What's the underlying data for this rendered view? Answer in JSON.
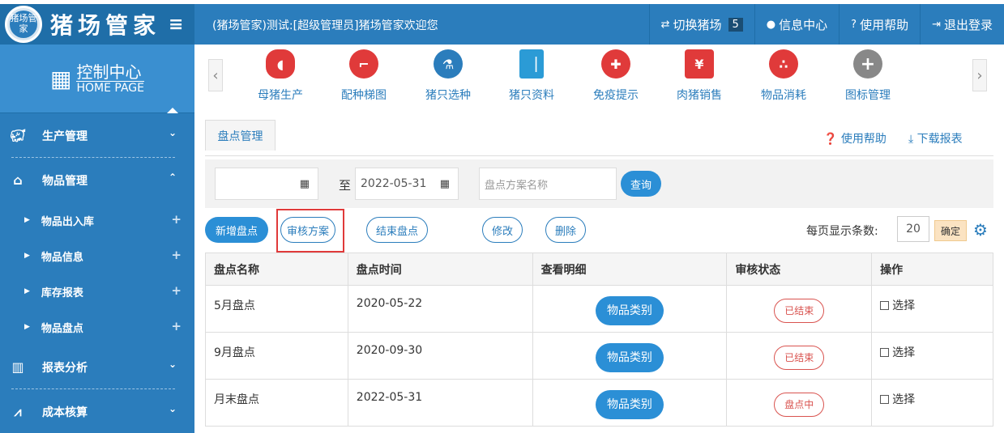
{
  "app": {
    "logo_text": "猪场管家",
    "title": "猪场管家",
    "welcome": "(猪场管家)测试:[超级管理员]猪场管家欢迎您"
  },
  "topnav": {
    "switch_farm": "切换猪场",
    "farm_count": "5",
    "info_center": "信息中心",
    "help": "使用帮助",
    "logout": "退出登录"
  },
  "sidebar": {
    "control_center": "控制中心",
    "home_page": "HOME PAGE",
    "menus": [
      {
        "label": "生产管理",
        "icon": "pig-outline-icon"
      },
      {
        "label": "物品管理",
        "icon": "warehouse-icon"
      },
      {
        "label": "报表分析",
        "icon": "chart-icon"
      },
      {
        "label": "成本核算",
        "icon": "cost-chart-icon"
      }
    ],
    "sub_items": [
      {
        "label": "物品出入库"
      },
      {
        "label": "物品信息"
      },
      {
        "label": "库存报表"
      },
      {
        "label": "物品盘点"
      }
    ]
  },
  "shortcuts": [
    {
      "label": "母猪生产",
      "icon": "pig-icon",
      "color": "#e03a3a"
    },
    {
      "label": "配种梯图",
      "icon": "stairs-icon",
      "color": "#e03a3a"
    },
    {
      "label": "猪只选种",
      "icon": "flask-icon",
      "color": "#2b7dbc"
    },
    {
      "label": "猪只资料",
      "icon": "book-icon",
      "color": "#2b9bd6"
    },
    {
      "label": "免疫提示",
      "icon": "heart-cross-icon",
      "color": "#e03a3a"
    },
    {
      "label": "肉猪销售",
      "icon": "money-stack-icon",
      "color": "#e03a3a"
    },
    {
      "label": "物品消耗",
      "icon": "circles-icon",
      "color": "#e03a3a"
    },
    {
      "label": "图标管理",
      "icon": "plus-circle-icon",
      "color": "#888888"
    }
  ],
  "tab": {
    "label": "盘点管理"
  },
  "links": {
    "help": "使用帮助",
    "download": "下载报表"
  },
  "filter": {
    "start_date": "",
    "to_label": "至",
    "end_date": "2022-05-31",
    "search_placeholder": "盘点方案名称",
    "query_button": "查询"
  },
  "actions": {
    "add": "新增盘点",
    "review": "审核方案",
    "finish": "结束盘点",
    "edit": "修改",
    "delete": "删除",
    "page_size_label": "每页显示条数:",
    "page_size": "20",
    "confirm": "确定"
  },
  "table": {
    "headers": [
      "盘点名称",
      "盘点时间",
      "查看明细",
      "审核状态",
      "操作"
    ],
    "rows": [
      {
        "name": "5月盘点",
        "date": "2020-05-22",
        "detail": "物品类别",
        "status": "已结束",
        "action": "选择"
      },
      {
        "name": "9月盘点",
        "date": "2020-09-30",
        "detail": "物品类别",
        "status": "已结束",
        "action": "选择"
      },
      {
        "name": "月末盘点",
        "date": "2022-05-31",
        "detail": "物品类别",
        "status": "盘点中",
        "action": "选择"
      }
    ]
  }
}
